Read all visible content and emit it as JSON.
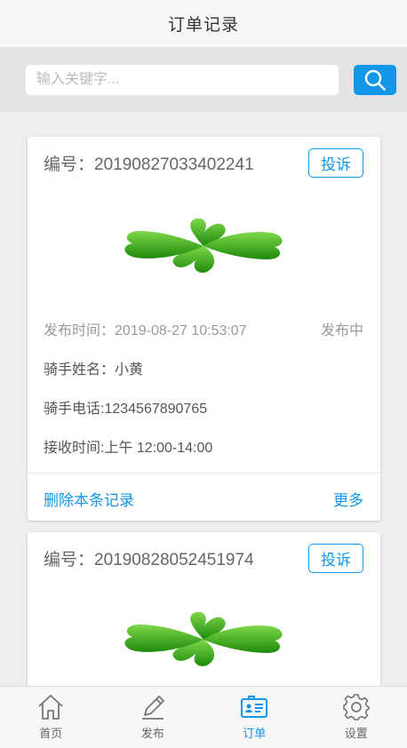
{
  "header": {
    "title": "订单记录"
  },
  "search": {
    "placeholder": "输入关键字..."
  },
  "orders": [
    {
      "order_no": "编号：20190827033402241",
      "complain_label": "投诉",
      "publish_label": "发布时间：",
      "publish_time": "2019-08-27 10:53:07",
      "status": "发布中",
      "rider_name": "骑手姓名：小黄",
      "rider_phone": "骑手电话:1234567890765",
      "receive_time": "接收时间:上午 12:00-14:00",
      "delete_label": "删除本条记录",
      "more_label": "更多"
    },
    {
      "order_no": "编号：20190828052451974",
      "complain_label": "投诉"
    }
  ],
  "tabs": [
    {
      "label": "首页",
      "icon": "home-icon"
    },
    {
      "label": "发布",
      "icon": "pencil-icon"
    },
    {
      "label": "订单",
      "icon": "order-card-icon",
      "active": true
    },
    {
      "label": "设置",
      "icon": "gear-icon"
    }
  ],
  "colors": {
    "accent": "#1296e8",
    "clover": "#3bb314"
  }
}
